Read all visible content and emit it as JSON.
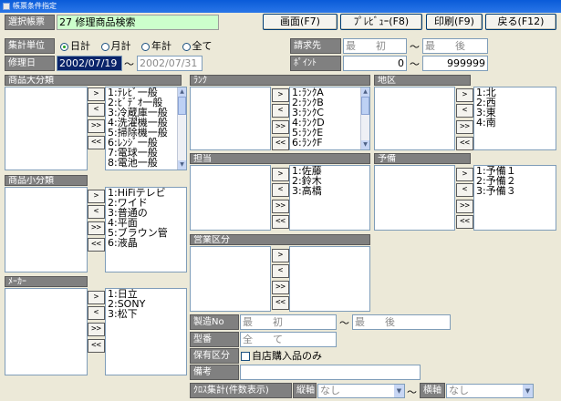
{
  "window": {
    "title": "帳票条件指定"
  },
  "report": {
    "label": "選択帳票",
    "number": "27",
    "name": "修理商品検索"
  },
  "toolbar": {
    "screen": "画面(F7)",
    "preview": "ﾌﾟﾚﾋﾞｭｰ(F8)",
    "print": "印刷(F9)",
    "back": "戻る(F12)"
  },
  "unit": {
    "label": "集計単位",
    "options": [
      "日計",
      "月計",
      "年計",
      "全て"
    ],
    "selected": "日計"
  },
  "repair_date": {
    "label": "修理日",
    "from": "2002/07/19",
    "sep": "～",
    "to": "2002/07/31"
  },
  "billing": {
    "label": "請求先",
    "from_placeholder": "最　　初",
    "sep": "～",
    "to_placeholder": "最　　後"
  },
  "points": {
    "label": "ﾎﾟｲﾝﾄ",
    "from": "0",
    "sep": "～",
    "to": "999999"
  },
  "arrows": {
    "add": ">",
    "remove": "<",
    "add_all": ">>",
    "remove_all": "<<"
  },
  "panels": {
    "major_category": {
      "label": "商品大分類",
      "items": [
        "1:ﾃﾚﾋﾞ一般",
        "2:ﾋﾞﾃﾞｵ一般",
        "3:冷蔵庫一般",
        "4:洗濯機一般",
        "5:掃除機一般",
        "6:ﾚﾝｼﾞ一般",
        "7:電球一般",
        "8:電池一般"
      ]
    },
    "rank": {
      "label": "ﾗﾝｸ",
      "items": [
        "1:ﾗﾝｸA",
        "2:ﾗﾝｸB",
        "3:ﾗﾝｸC",
        "4:ﾗﾝｸD",
        "5:ﾗﾝｸE",
        "6:ﾗﾝｸF"
      ]
    },
    "region": {
      "label": "地区",
      "items": [
        "1:北",
        "2:西",
        "3:東",
        "4:南"
      ]
    },
    "minor_category": {
      "label": "商品小分類",
      "items": [
        "1:HiFiテレビ",
        "2:ワイド",
        "3:普通の",
        "4:平面",
        "5:ブラウン管",
        "6:液晶"
      ]
    },
    "staff": {
      "label": "担当",
      "items": [
        "1:佐藤",
        "2:鈴木",
        "3:高橋"
      ]
    },
    "reserve": {
      "label": "予備",
      "items": [
        "1:予備１",
        "2:予備２",
        "3:予備３"
      ]
    },
    "sales_div": {
      "label": "営業区分",
      "items": []
    },
    "maker": {
      "label": "ﾒｰｶｰ",
      "items": [
        "1:日立",
        "2:SONY",
        "3:松下"
      ]
    }
  },
  "serial": {
    "label": "製造No",
    "from_placeholder": "最　　初",
    "sep": "～",
    "to_placeholder": "最　　後"
  },
  "model": {
    "label": "型番",
    "placeholder": "全　　て"
  },
  "holding": {
    "label": "保有区分",
    "checkbox": "自店購入品のみ"
  },
  "remarks": {
    "label": "備考",
    "value": ""
  },
  "cross": {
    "label": "ｸﾛｽ集計(件数表示)",
    "vertical_label": "縦軸",
    "vertical_value": "なし",
    "sep": "～",
    "horizontal_label": "横軸",
    "horizontal_value": "なし"
  },
  "colors": {
    "titlebar": "#0a5bd8",
    "header": "#808080",
    "selection": "#0a246a",
    "report_field": "#ccffcc"
  }
}
